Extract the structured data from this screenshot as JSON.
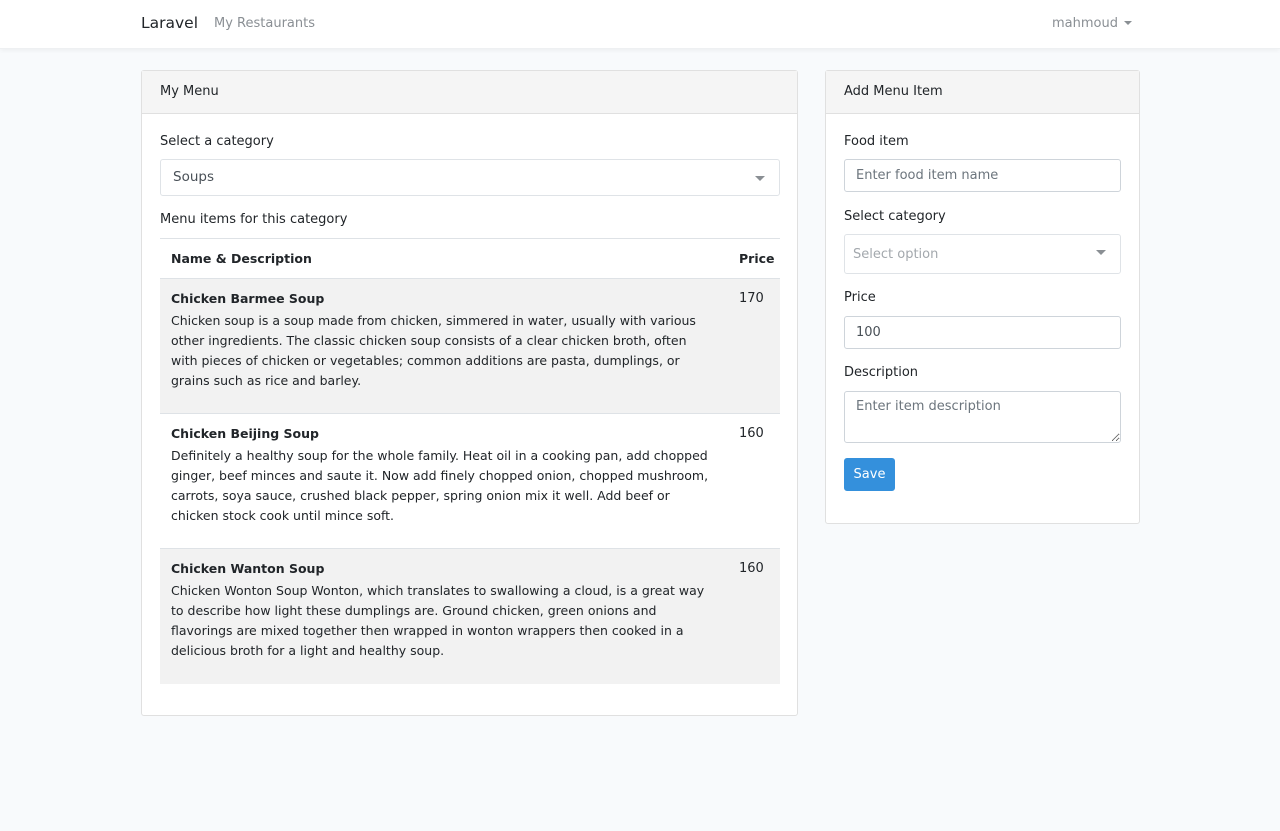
{
  "navbar": {
    "brand": "Laravel",
    "nav_link": "My Restaurants",
    "user": "mahmoud"
  },
  "menu_card": {
    "title": "My Menu",
    "category_label": "Select a category",
    "selected_category": "Soups",
    "items_heading": "Menu items for this category",
    "columns": [
      "Name & Description",
      "Price"
    ],
    "items": [
      {
        "name": "Chicken Barmee Soup",
        "description": "Chicken soup is a soup made from chicken, simmered in water, usually with various other ingredients. The classic chicken soup consists of a clear chicken broth, often with pieces of chicken or vegetables; common additions are pasta, dumplings, or grains such as rice and barley.",
        "price": "170"
      },
      {
        "name": "Chicken Beijing Soup",
        "description": "Definitely a healthy soup for the whole family. Heat oil in a cooking pan, add chopped ginger, beef minces and saute it. Now add finely chopped onion, chopped mushroom, carrots, soya sauce, crushed black pepper, spring onion mix it well. Add beef or chicken stock cook until mince soft.",
        "price": "160"
      },
      {
        "name": "Chicken Wanton Soup",
        "description": "Chicken Wonton Soup Wonton, which translates to swallowing a cloud, is a great way to describe how light these dumplings are. Ground chicken, green onions and flavorings are mixed together then wrapped in wonton wrappers then cooked in a delicious broth for a light and healthy soup.",
        "price": "160"
      }
    ]
  },
  "add_card": {
    "title": "Add Menu Item",
    "food_label": "Food item",
    "food_placeholder": "Enter food item name",
    "category_label": "Select category",
    "category_placeholder": "Select option",
    "price_label": "Price",
    "price_value": "100",
    "description_label": "Description",
    "description_placeholder": "Enter item description",
    "save_label": "Save"
  },
  "colors": {
    "primary": "#3490dc",
    "background": "#f8fafc"
  }
}
